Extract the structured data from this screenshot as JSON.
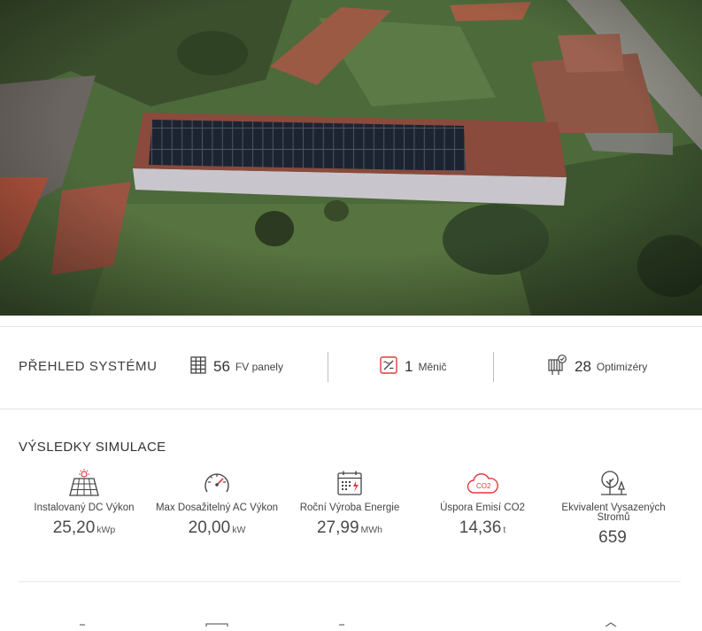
{
  "overview": {
    "title": "PŘEHLED SYSTÉMU",
    "panels": {
      "count": "56",
      "label": "FV panely",
      "icon": "solar-panel-grid-icon"
    },
    "inverters": {
      "count": "1",
      "label": "Měnič",
      "icon": "inverter-icon"
    },
    "optimizers": {
      "count": "28",
      "label": "Optimizéry",
      "icon": "optimizer-icon"
    }
  },
  "simulation": {
    "title": "VÝSLEDKY SIMULACE",
    "cards": [
      {
        "label": "Instalovaný DC Výkon",
        "value": "25,20",
        "unit": "kWp",
        "icon": "solar-panel-sun-icon"
      },
      {
        "label": "Max Dosažitelný AC Výkon",
        "value": "20,00",
        "unit": "kW",
        "icon": "gauge-icon"
      },
      {
        "label": "Roční Výroba Energie",
        "value": "27,99",
        "unit": "MWh",
        "icon": "calendar-icon"
      },
      {
        "label": "Úspora Emisí CO2",
        "value": "14,36",
        "unit": "t",
        "icon": "co2-cloud-icon"
      },
      {
        "label": "Ekvivalent Vysazených Stromů",
        "value": "659",
        "unit": "",
        "icon": "trees-icon"
      }
    ]
  },
  "colors": {
    "accent": "#e2393e",
    "text": "#333333",
    "separator": "#bdbdbd"
  }
}
